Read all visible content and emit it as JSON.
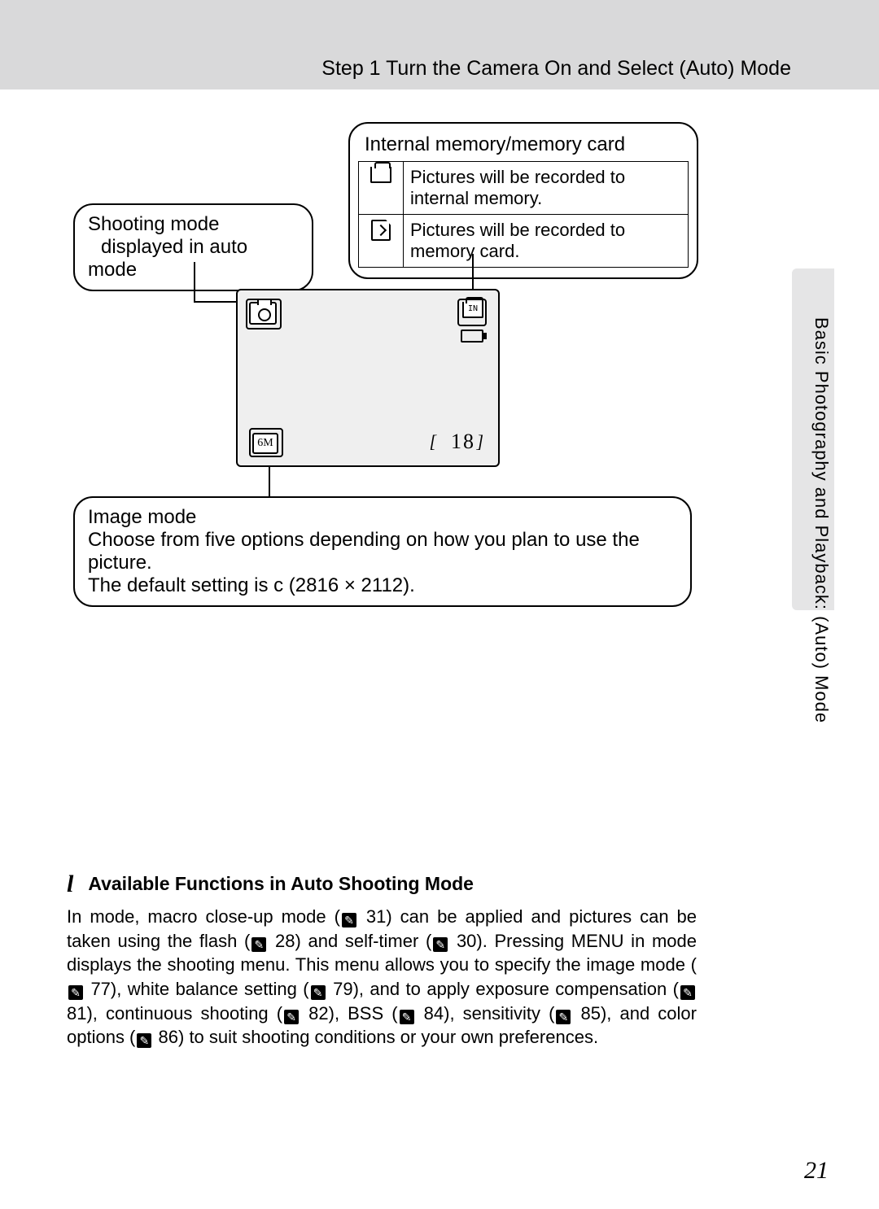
{
  "header": {
    "step_title": "Step 1 Turn the Camera On and Select       (Auto) Mode"
  },
  "side": {
    "chapter": "Basic Photography and Playback:      (Auto) Mode"
  },
  "callouts": {
    "shooting": {
      "l1": "Shooting mode",
      "l2": "displayed in auto mode"
    },
    "memory": {
      "heading": "Internal memory/memory card",
      "row1": "Pictures will be recorded to internal memory.",
      "row2": "Pictures will be recorded to memory card."
    },
    "image_mode": {
      "l1": "Image mode",
      "l2": "Choose from five options depending on how you plan to use the picture.",
      "l3": "The default setting is c   (2816 × 2112)."
    }
  },
  "monitor": {
    "in_label": "IN",
    "sixm": "6M",
    "lbracket": "[",
    "shots_remaining": "18",
    "rbracket": "]"
  },
  "functions": {
    "heading": "Available Functions in Auto Shooting Mode",
    "paragraph": {
      "p1a": "In ",
      "p1b": " mode, macro close-up mode (",
      "r1": "31",
      "p2": ") can be applied and pictures can be taken using the flash (",
      "r2": "28",
      "p3": ") and self-timer (",
      "r3": "30",
      "p4": "). Pressing ",
      "menu": "MENU",
      "p5": " in      mode displays the shooting menu. This menu allows you to specify the image mode (",
      "r4": "77",
      "p6": "), white balance setting (",
      "r5": "79",
      "p7": "), and to apply exposure compensation (",
      "r6": "81",
      "p8": "), continuous shooting (",
      "r7": "82",
      "p9": "), BSS (",
      "r8": "84",
      "p10": "), sensitivity (",
      "r9": "85",
      "p11": "), and color options (",
      "r10": "86",
      "p12": ") to suit shooting conditions or your own preferences."
    }
  },
  "page_number": "21",
  "chart_data": null
}
